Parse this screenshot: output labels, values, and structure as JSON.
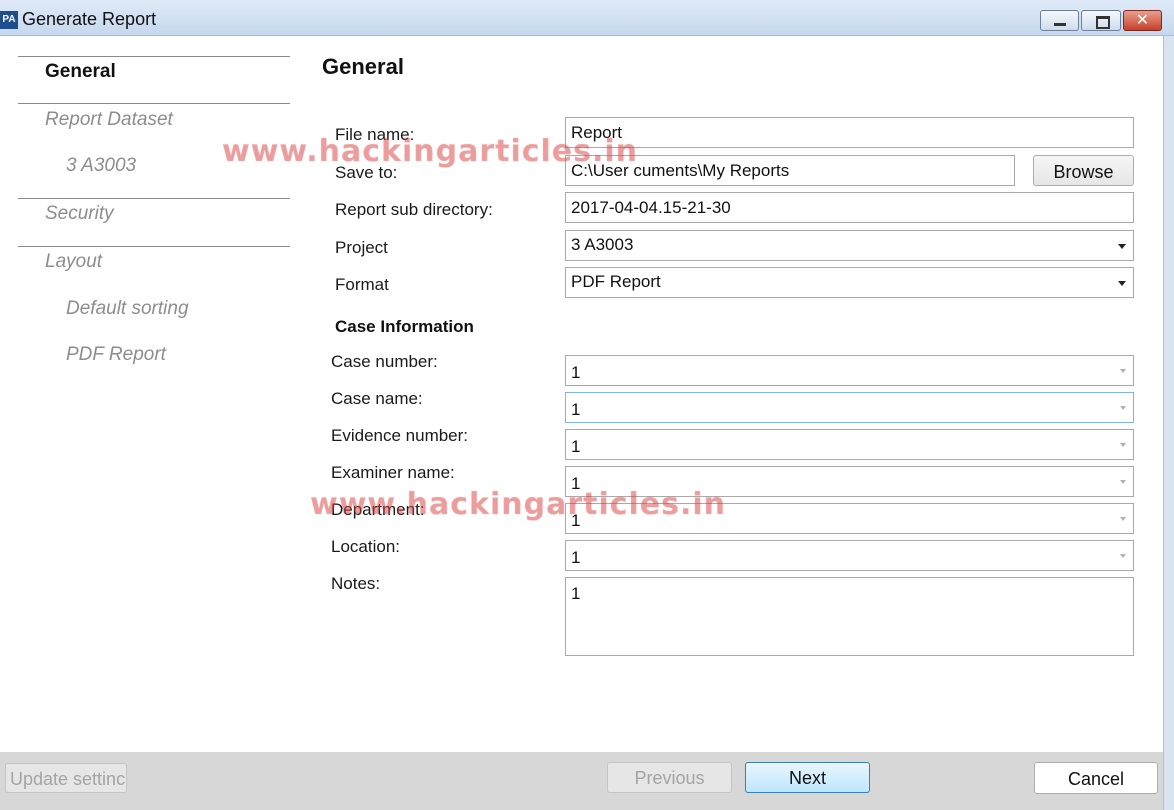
{
  "window": {
    "app_icon_text": "PA",
    "title": "Generate Report",
    "close_glyph": "✕"
  },
  "nav": {
    "items": [
      {
        "label": "General",
        "active": true
      },
      {
        "label": "Report Dataset"
      },
      {
        "label": "3 A3003"
      },
      {
        "label": "Security"
      },
      {
        "label": "Layout"
      },
      {
        "label": "Default sorting"
      },
      {
        "label": "PDF Report"
      }
    ]
  },
  "page": {
    "title": "General"
  },
  "form": {
    "file_name": {
      "label": "File name:",
      "value": "Report"
    },
    "save_to": {
      "label": "Save to:",
      "value": "C:\\User              cuments\\My Reports",
      "button": "Browse"
    },
    "sub_dir": {
      "label": "Report sub directory:",
      "value": "2017-04-04.15-21-30"
    },
    "project": {
      "label": "Project",
      "value": "3 A3003"
    },
    "format": {
      "label": "Format",
      "value": "PDF Report"
    }
  },
  "case_info": {
    "heading": "Case Information",
    "case_number": {
      "label": "Case number:",
      "value": "1"
    },
    "case_name": {
      "label": "Case name:",
      "value": "1"
    },
    "evidence_number": {
      "label": "Evidence number:",
      "value": "1"
    },
    "examiner_name": {
      "label": "Examiner name:",
      "value": "1"
    },
    "department": {
      "label": "Department:",
      "value": "1"
    },
    "location": {
      "label": "Location:",
      "value": "1"
    },
    "notes": {
      "label": "Notes:",
      "value": "1"
    }
  },
  "footer": {
    "update_settings": "Update settinc",
    "previous": "Previous",
    "next": "Next",
    "cancel": "Cancel"
  },
  "watermark": {
    "text": "www.hackingarticles.in"
  },
  "icons": {
    "minimize": "minimize-icon",
    "maximize": "maximize-icon",
    "close": "close-icon",
    "dropdown": "chevron-down-icon"
  }
}
